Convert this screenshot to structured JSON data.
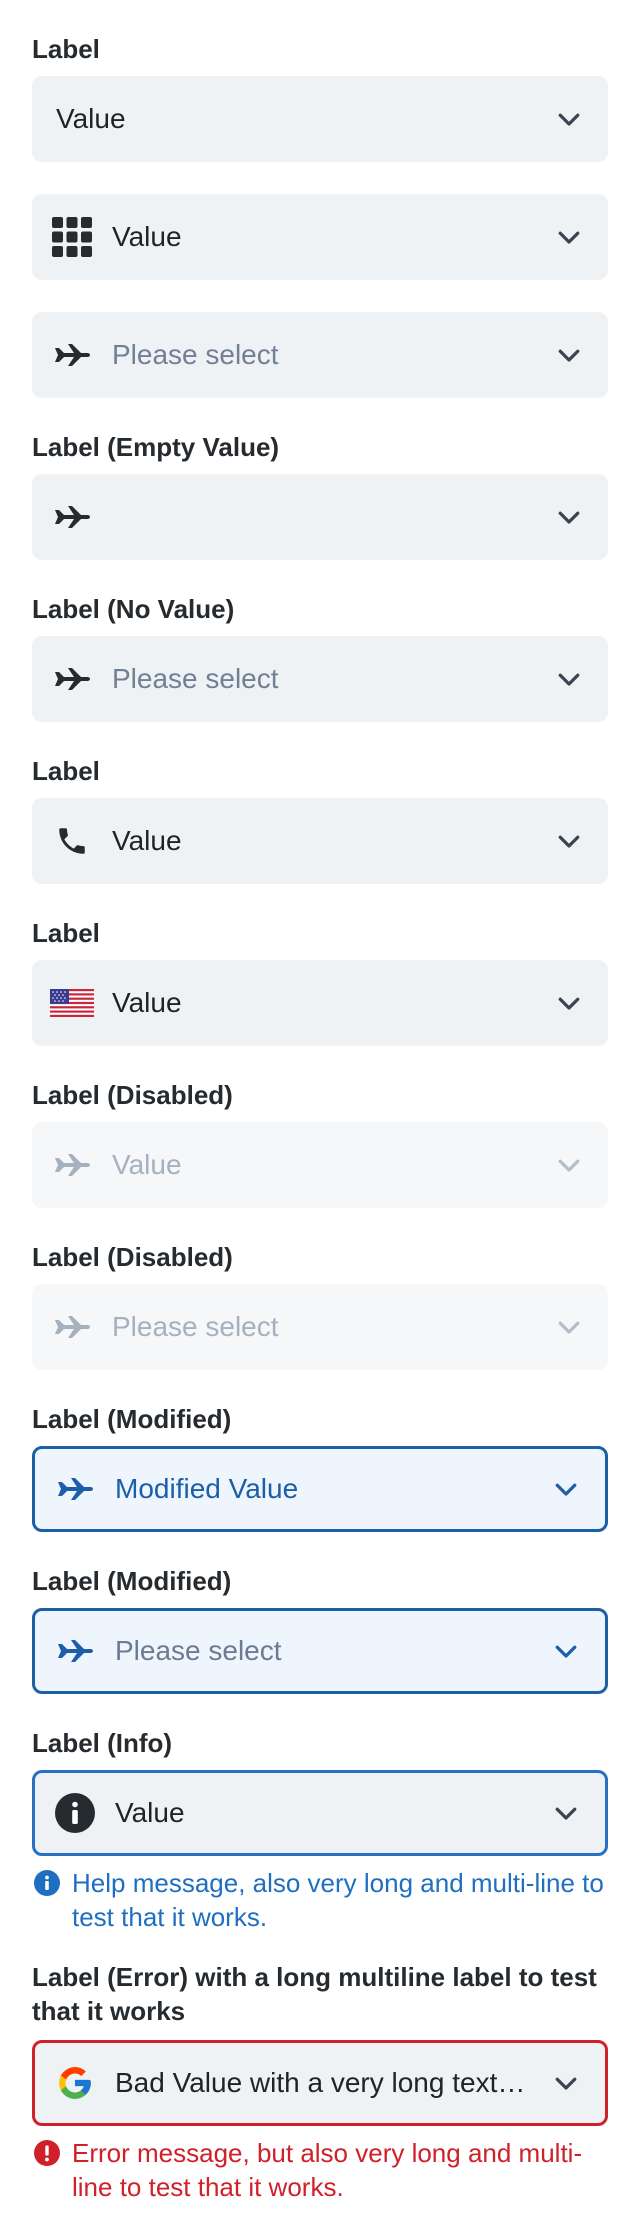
{
  "fields": [
    {
      "label": "Label",
      "value": "Value"
    },
    {
      "value": "Value"
    },
    {
      "placeholder": "Please select"
    },
    {
      "label": "Label (Empty Value)",
      "value": ""
    },
    {
      "label": "Label (No Value)",
      "placeholder": "Please select"
    },
    {
      "label": "Label",
      "value": "Value"
    },
    {
      "label": "Label",
      "value": "Value"
    },
    {
      "label": "Label (Disabled)",
      "value": "Value"
    },
    {
      "label": "Label (Disabled)",
      "placeholder": "Please select"
    },
    {
      "label": "Label (Modified)",
      "value": "Modified Value"
    },
    {
      "label": "Label (Modified)",
      "placeholder": "Please select"
    },
    {
      "label": "Label (Info)",
      "value": "Value",
      "help": "Help message, also very long and multi-line to test that it works."
    },
    {
      "label": "Label (Error) with a long multiline label to test that it works",
      "value": "Bad Value with a very long text to test that it truncates",
      "error": "Error message, but also very long and multi-line to test that it works."
    }
  ],
  "icons": {
    "grid": "grid-icon",
    "plane": "airplane-icon",
    "phone": "phone-icon",
    "flag": "us-flag-icon",
    "info": "info-icon",
    "google": "google-icon",
    "error": "error-icon",
    "chevron": "chevron-down-icon"
  },
  "colors": {
    "field_bg": "#eff2f5",
    "modified_border": "#1d5fa6",
    "info_border": "#2a70c2",
    "error": "#d0202a",
    "info_text": "#1f6fc1"
  }
}
